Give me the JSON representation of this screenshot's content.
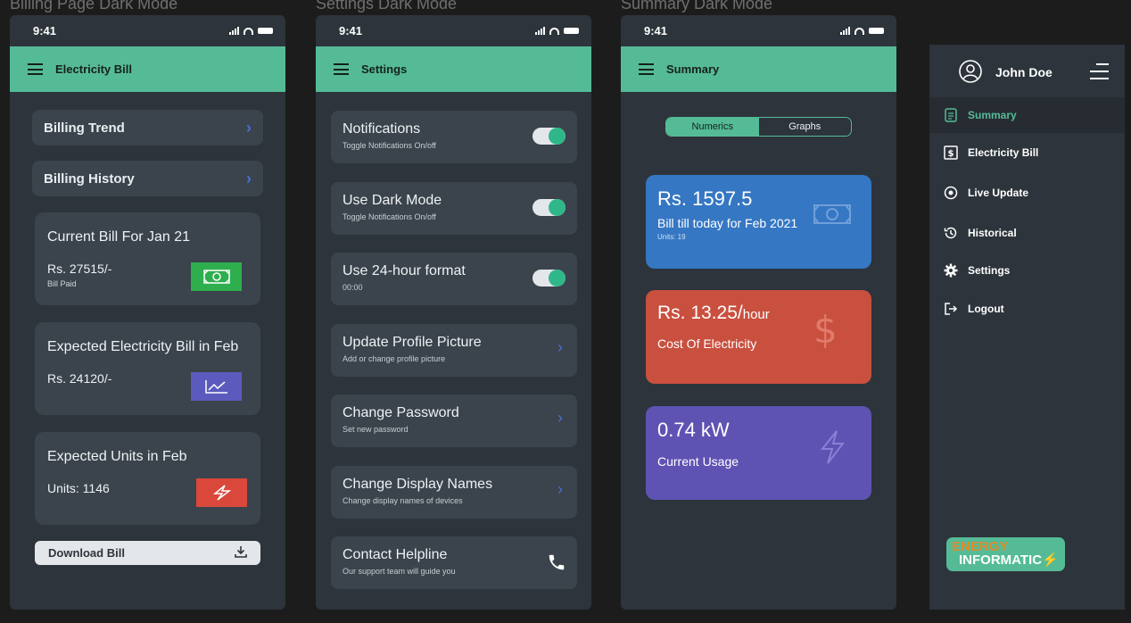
{
  "frames": {
    "billing": "Billing Page Dark Mode",
    "settings": "Settings Dark Mode",
    "summary": "Summary Dark Mode"
  },
  "status_time": "9:41",
  "billing": {
    "title": "Electricity Bill",
    "billing_trend": "Billing Trend",
    "billing_history": "Billing History",
    "current_bill": {
      "heading": "Current Bill For Jan 21",
      "amount": "Rs. 27515/-",
      "status": "Bill Paid",
      "icon": "cash-icon",
      "color": "#2fae4e"
    },
    "expected_bill": {
      "heading": "Expected Electricity Bill in Feb",
      "amount": "Rs. 24120/-",
      "icon": "trend-chart-icon",
      "color": "#5b5bbd"
    },
    "expected_units": {
      "heading": "Expected Units in Feb",
      "units": "Units: 1146",
      "icon": "lightning-icon",
      "color": "#d9483b"
    },
    "download": "Download Bill"
  },
  "settings": {
    "title": "Settings",
    "items": [
      {
        "title": "Notifications",
        "subtitle": "Toggle Notifications On/off",
        "control": "toggle-on"
      },
      {
        "title": "Use Dark Mode",
        "subtitle": "Toggle Notifications On/off",
        "control": "toggle-on"
      },
      {
        "title": "Use 24-hour format",
        "subtitle": "00:00",
        "control": "toggle-on"
      },
      {
        "title": "Update Profile Picture",
        "subtitle": "Add or change profile picture",
        "control": "chevron"
      },
      {
        "title": "Change Password",
        "subtitle": "Set new password",
        "control": "chevron"
      },
      {
        "title": "Change Display Names",
        "subtitle": "Change display names of devices",
        "control": "chevron"
      },
      {
        "title": "Contact Helpline",
        "subtitle": "Our support team will guide you",
        "control": "phone-icon"
      }
    ]
  },
  "summary": {
    "title": "Summary",
    "tabs": [
      "Numerics",
      "Graphs"
    ],
    "active_tab": "Numerics",
    "bill_card": {
      "value": "Rs. 1597.5",
      "label": "Bill till today for Feb 2021",
      "sub": "Units: 19",
      "color": "#3577c3"
    },
    "cost_card": {
      "value": "Rs. 13.25/",
      "unit": "hour",
      "label": "Cost Of Electricity",
      "color": "#c9503f"
    },
    "usage_card": {
      "value": "0.74 kW",
      "label": "Current Usage",
      "color": "#5e53b3"
    }
  },
  "drawer": {
    "user": "John Doe",
    "items": [
      "Summary",
      "Electricity Bill",
      "Live Update",
      "Historical",
      "Settings",
      "Logout"
    ],
    "active": "Summary",
    "logo_line1": "ENERGY",
    "logo_line2": "INFORMATIC"
  },
  "colors": {
    "accent": "#55bb96",
    "panel": "#2d343b",
    "card": "#3b434c",
    "background": "#1c1c1c"
  }
}
